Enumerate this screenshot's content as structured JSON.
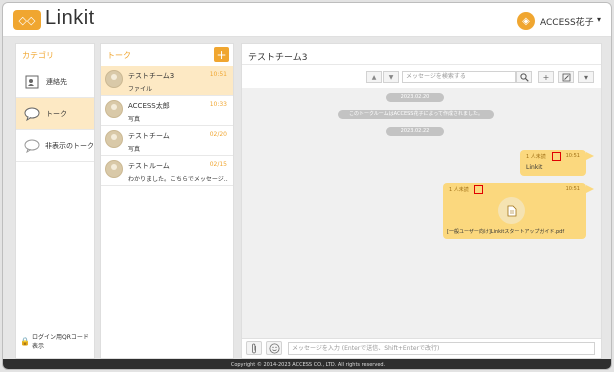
{
  "header": {
    "logo_mark": "◇◇",
    "app_name": "Linkit",
    "user_name": "ACCESS花子",
    "user_caret": "▾"
  },
  "categories": {
    "title": "カテゴリ",
    "items": [
      {
        "label": "連絡先",
        "icon": "contact-card-icon"
      },
      {
        "label": "トーク",
        "icon": "speech-bubble-icon"
      },
      {
        "label": "非表示のトーク",
        "icon": "speech-bubble-outline-icon"
      }
    ],
    "footer": "ログイン用QRコード表示"
  },
  "talks": {
    "title": "トーク",
    "add_label": "+",
    "items": [
      {
        "name": "テストチーム3",
        "time": "10:51",
        "preview": "ファイル"
      },
      {
        "name": "ACCESS太郎",
        "time": "10:33",
        "preview": "写真"
      },
      {
        "name": "テストチーム",
        "time": "02/20",
        "preview": "写真"
      },
      {
        "name": "テストルーム",
        "time": "02/15",
        "preview": "わかりました。こちらでメッセージ…"
      }
    ]
  },
  "chat": {
    "title": "テストチーム3",
    "search_placeholder": "メッセージを検索する",
    "up_label": "▲",
    "down_label": "▼",
    "dates": [
      "2023.02.20",
      "2023.02.22"
    ],
    "system_message": "このトークルームはACCESS花子によって作成されました。",
    "messages": [
      {
        "read": "1 人未読",
        "time": "10:51",
        "text": "Linkit"
      },
      {
        "read": "1 人未読",
        "time": "10:51",
        "file": "[一般ユーザー向け]Linkitスタートアップガイド.pdf"
      }
    ],
    "input_placeholder": "メッセージを入力 (Enterで送信、Shift+Enterで改行)"
  },
  "footer": {
    "copyright": "Copyright © 2014-2023 ACCESS CO., LTD. All rights reserved."
  },
  "colors": {
    "accent": "#f0a630",
    "bubble": "#fbd87e",
    "active_row": "#fde9c4",
    "highlight": "#e00000"
  }
}
